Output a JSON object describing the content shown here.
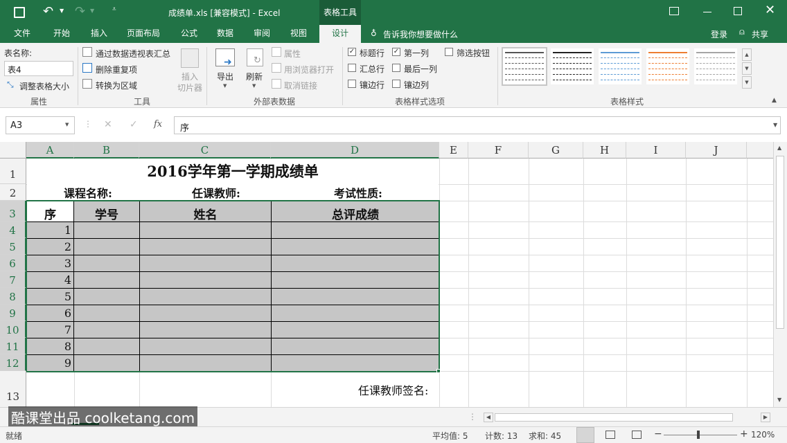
{
  "titlebar": {
    "doc_title": "成绩单.xls [兼容模式] - Excel",
    "context_tab": "表格工具",
    "colors": {
      "accent": "#217346",
      "table_fill": "#c6c6c6",
      "grid": "#dcdcdc"
    }
  },
  "tabs": [
    "文件",
    "开始",
    "插入",
    "页面布局",
    "公式",
    "数据",
    "审阅",
    "视图",
    "设计"
  ],
  "tell_me": "告诉我你想要做什么",
  "account": {
    "login": "登录",
    "share": "共享"
  },
  "ribbon": {
    "properties": {
      "table_name_label": "表名称:",
      "table_name_value": "表4",
      "resize": "调整表格大小",
      "group": "属性"
    },
    "tools": {
      "pivot": "通过数据透视表汇总",
      "remove_dup": "删除重复项",
      "convert": "转换为区域",
      "slicer_line1": "插入",
      "slicer_line2": "切片器",
      "group": "工具"
    },
    "external": {
      "export": "导出",
      "refresh": "刷新",
      "properties": "属性",
      "open_browser": "用浏览器打开",
      "unlink": "取消链接",
      "group": "外部表数据"
    },
    "style_options": {
      "header_row": "标题行",
      "total_row": "汇总行",
      "banded_rows": "镶边行",
      "first_col": "第一列",
      "last_col": "最后一列",
      "banded_cols": "镶边列",
      "filter_btn": "筛选按钮",
      "check_mark": "✓",
      "group": "表格样式选项"
    },
    "table_styles": {
      "group": "表格样式",
      "swatches": [
        "#555555",
        "#222222",
        "#5b9bd5",
        "#ed7d31",
        "#a5a5a5"
      ]
    }
  },
  "formula_bar": {
    "name_box": "A3",
    "fx": "fx",
    "content": "序"
  },
  "sheet": {
    "columns": [
      "A",
      "B",
      "C",
      "D",
      "E",
      "F",
      "G",
      "H",
      "I",
      "J"
    ],
    "rows": [
      "1",
      "2",
      "3",
      "4",
      "5",
      "6",
      "7",
      "8",
      "9",
      "10",
      "11",
      "12",
      "13"
    ],
    "title": "2016学年第一学期成绩单",
    "course_label": "课程名称:",
    "teacher_label": "任课教师:",
    "exam_label": "考试性质:",
    "headers": [
      "序",
      "学号",
      "姓名",
      "总评成绩"
    ],
    "serials": [
      "1",
      "2",
      "3",
      "4",
      "5",
      "6",
      "7",
      "8",
      "9"
    ],
    "signature": "任课教师签名:"
  },
  "watermark": "酷课堂出品 coolketang.com",
  "statusbar": {
    "ready": "就绪",
    "average": "平均值: 5",
    "count": "计数: 13",
    "sum": "求和: 45",
    "zoom": "120%"
  }
}
